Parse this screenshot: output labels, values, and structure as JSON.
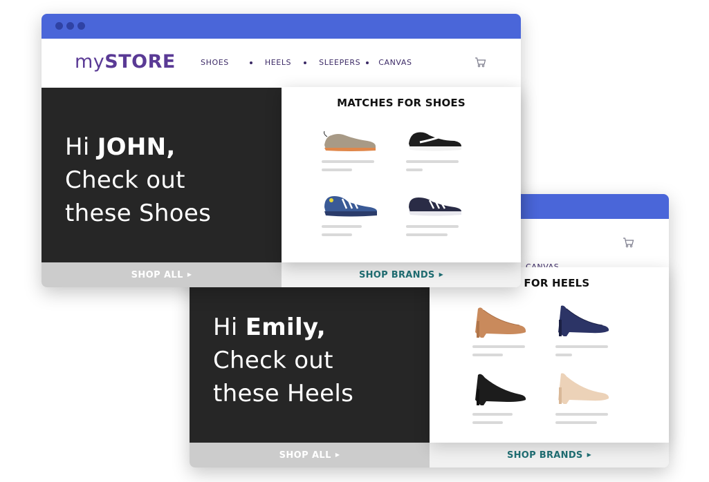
{
  "store": {
    "logo_prefix": "my",
    "logo_bold": "STORE",
    "nav": [
      "SHOES",
      "HEELS",
      "SLEEPERS",
      "CANVAS"
    ]
  },
  "front": {
    "greeting": "Hi",
    "name": "JOHN,",
    "line2": "Check out",
    "line3": "these Shoes",
    "matches_title": "MATCHES FOR SHOES",
    "shop_all": "SHOP ALL",
    "shop_brands": "SHOP BRANDS",
    "products": [
      "tan-sneaker",
      "black-white-running-shoe",
      "blue-running-shoe",
      "navy-running-shoe"
    ]
  },
  "back": {
    "greeting": "Hi",
    "name": "Emily,",
    "line2": "Check out",
    "line3": "these Heels",
    "matches_title_partial": "S FOR HEELS",
    "nav_visible": "CANVAS",
    "shop_all": "SHOP ALL",
    "shop_brands": "SHOP BRANDS",
    "products": [
      "tan-pump",
      "navy-pump",
      "black-pump",
      "nude-pump"
    ]
  },
  "colors": {
    "titlebar": "#4a66d9",
    "logo": "#5a3a95",
    "hero_bg": "#262626",
    "brand_link": "#1f6f74"
  },
  "icons": {
    "cart": "cart-icon",
    "arrow": "triangle-right-icon"
  }
}
